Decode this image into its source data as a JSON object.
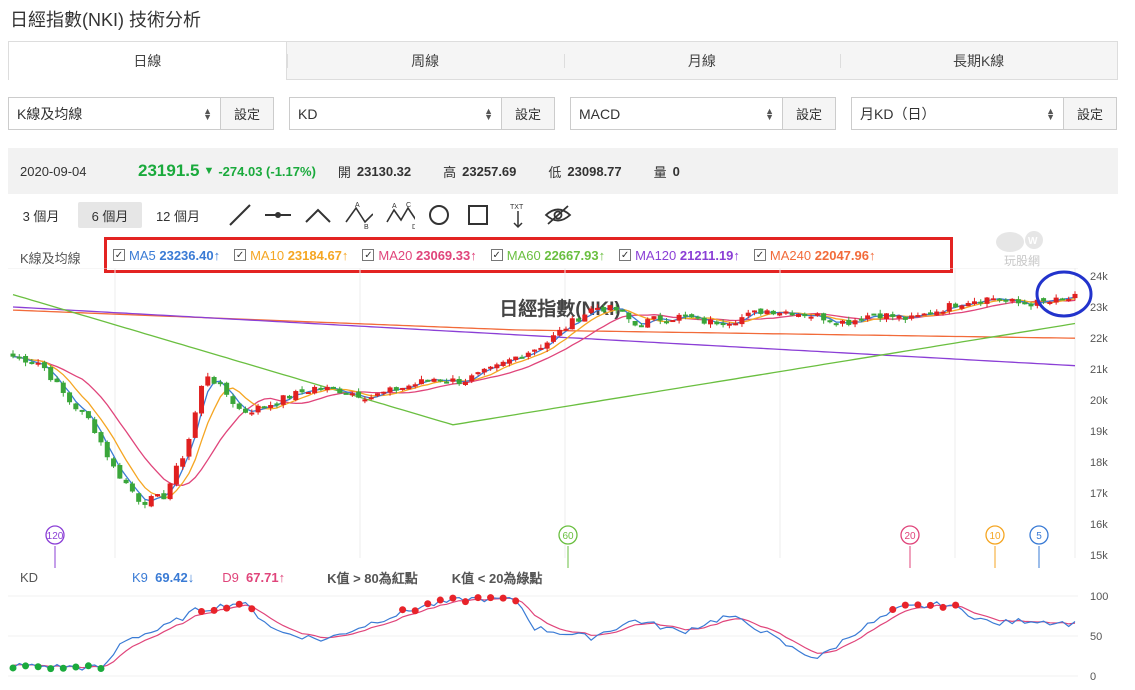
{
  "page": {
    "title": "日經指數(NKI) 技術分析"
  },
  "tabs": [
    {
      "label": "日線",
      "active": true
    },
    {
      "label": "周線",
      "active": false
    },
    {
      "label": "月線",
      "active": false
    },
    {
      "label": "長期K線",
      "active": false
    }
  ],
  "selectors": [
    {
      "value": "K線及均線",
      "button": "設定"
    },
    {
      "value": "KD",
      "button": "設定"
    },
    {
      "value": "MACD",
      "button": "設定"
    },
    {
      "value": "月KD（日）",
      "button": "設定"
    }
  ],
  "quote": {
    "date": "2020-09-04",
    "price": "23191.5",
    "change": "-274.03 (-1.17%)",
    "open_label": "開",
    "open": "23130.32",
    "high_label": "高",
    "high": "23257.69",
    "low_label": "低",
    "low": "23098.77",
    "volume_label": "量",
    "volume": "0",
    "down_color": "#1aaa3c"
  },
  "ranges": [
    {
      "label": "3 個月",
      "active": false
    },
    {
      "label": "6 個月",
      "active": true
    },
    {
      "label": "12 個月",
      "active": false
    }
  ],
  "tools": [
    "line-tool-icon",
    "horizontal-line-icon",
    "angle-tool-icon",
    "abc-pattern-icon",
    "abcd-pattern-icon",
    "circle-tool-icon",
    "rectangle-tool-icon",
    "text-tool-icon",
    "hide-drawings-icon"
  ],
  "text_tool_label": "TXT",
  "abc_labels": [
    "A",
    "B",
    "C",
    "D"
  ],
  "ma_panel": {
    "label": "K線及均線",
    "items": [
      {
        "name": "MA5",
        "value": "23236.40",
        "arrow": "↑",
        "color": "#3a7bd5"
      },
      {
        "name": "MA10",
        "value": "23184.67",
        "arrow": "↑",
        "color": "#f5a623"
      },
      {
        "name": "MA20",
        "value": "23069.33",
        "arrow": "↑",
        "color": "#e0457b"
      },
      {
        "name": "MA60",
        "value": "22667.93",
        "arrow": "↑",
        "color": "#6abf40"
      },
      {
        "name": "MA120",
        "value": "21211.19",
        "arrow": "↑",
        "color": "#8b3fd6"
      },
      {
        "name": "MA240",
        "value": "22047.96",
        "arrow": "↑",
        "color": "#f26b3a"
      }
    ]
  },
  "watermark": "玩股網",
  "chart_data": {
    "type": "candlestick",
    "title": "日經指數(NKI)",
    "y_ticks": [
      "24k",
      "23k",
      "22k",
      "21k",
      "20k",
      "19k",
      "18k",
      "17k",
      "16k",
      "15k"
    ],
    "ylim": [
      15000,
      24000
    ],
    "markers": [
      "120",
      "60",
      "20",
      "10",
      "5"
    ],
    "highlight_circle_color": "#2233cc",
    "candles_sample": [
      {
        "o": 21300,
        "c": 21500,
        "up": false
      },
      {
        "o": 20600,
        "c": 20100,
        "up": false
      },
      {
        "o": 18400,
        "c": 17000,
        "up": false
      },
      {
        "o": 16500,
        "c": 16900,
        "up": true
      },
      {
        "o": 19100,
        "c": 20400,
        "up": true
      },
      {
        "o": 22700,
        "c": 23100,
        "up": true
      },
      {
        "o": 22700,
        "c": 23100,
        "up": true
      },
      {
        "o": 23300,
        "c": 23200,
        "up": false
      }
    ]
  },
  "kd": {
    "label": "KD",
    "k_label": "K9",
    "k_value": "69.42",
    "k_arrow": "↓",
    "k_color": "#3a7bd5",
    "d_label": "D9",
    "d_value": "67.71",
    "d_arrow": "↑",
    "d_color": "#e0457b",
    "note1": "K值 > 80為紅點",
    "note2": "K值 < 20為綠點",
    "y_ticks": [
      "100",
      "50",
      "0"
    ]
  }
}
